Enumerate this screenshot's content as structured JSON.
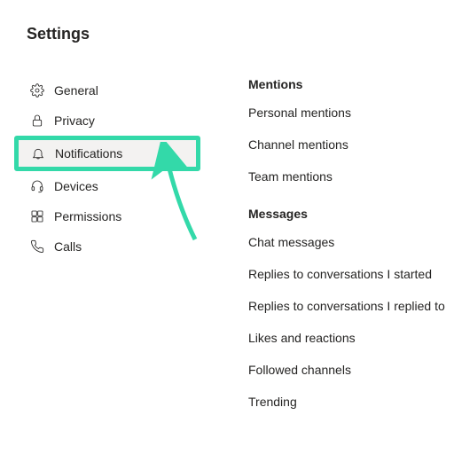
{
  "header": {
    "title": "Settings"
  },
  "sidebar": {
    "items": [
      {
        "label": "General"
      },
      {
        "label": "Privacy"
      },
      {
        "label": "Notifications"
      },
      {
        "label": "Devices"
      },
      {
        "label": "Permissions"
      },
      {
        "label": "Calls"
      }
    ]
  },
  "main": {
    "sections": [
      {
        "title": "Mentions",
        "options": [
          "Personal mentions",
          "Channel mentions",
          "Team mentions"
        ]
      },
      {
        "title": "Messages",
        "options": [
          "Chat messages",
          "Replies to conversations I started",
          "Replies to conversations I replied to",
          "Likes and reactions",
          "Followed channels",
          "Trending"
        ]
      }
    ]
  },
  "highlight_color": "#33d9a9"
}
